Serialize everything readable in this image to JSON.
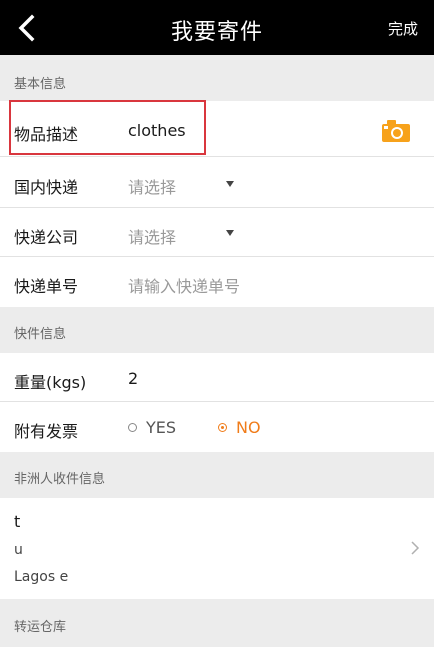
{
  "topbar": {
    "back_icon": "chevron-left-icon",
    "title": "我要寄件",
    "done_label": "完成"
  },
  "basic_info": {
    "header": "基本信息",
    "item_desc": {
      "label": "物品描述",
      "value": "clothes",
      "icon": "camera-icon",
      "icon_color": "#f7a21b"
    },
    "domestic_express": {
      "label": "国内快递",
      "placeholder": "请选择"
    },
    "courier_company": {
      "label": "快递公司",
      "placeholder": "请选择"
    },
    "tracking_number": {
      "label": "快递单号",
      "placeholder": "请输入快递单号"
    }
  },
  "parcel_info": {
    "header": "快件信息",
    "weight": {
      "label": "重量(kgs)",
      "value": "2"
    },
    "invoice": {
      "label": "附有发票",
      "options": [
        {
          "label": "YES",
          "selected": false
        },
        {
          "label": "NO",
          "selected": true
        }
      ],
      "selected_color": "#f07c1a"
    }
  },
  "recipient": {
    "header": "非洲人收件信息",
    "name": "t",
    "line2": "u",
    "address": "Lagos e"
  },
  "warehouse": {
    "header": "转运仓库"
  },
  "colors": {
    "accent": "#f07c1a",
    "highlight_border": "#d9363e",
    "topbar_bg": "#000000",
    "section_bg": "#ececec"
  }
}
